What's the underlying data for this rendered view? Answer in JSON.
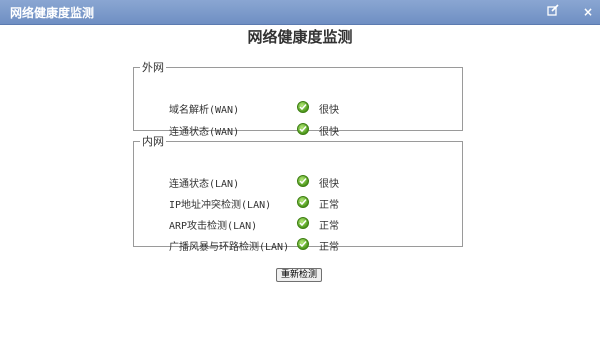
{
  "window": {
    "title": "网络健康度监测",
    "edit_icon": "edit-icon",
    "close_icon": "close-icon"
  },
  "page_title": "网络健康度监测",
  "wan": {
    "legend": "外网",
    "items": [
      {
        "label": "域名解析(WAN)",
        "status": "很快"
      },
      {
        "label": "连通状态(WAN)",
        "status": "很快"
      }
    ]
  },
  "lan": {
    "legend": "内网",
    "items": [
      {
        "label": "连通状态(LAN)",
        "status": "很快"
      },
      {
        "label": "IP地址冲突检测(LAN)",
        "status": "正常"
      },
      {
        "label": "ARP攻击检测(LAN)",
        "status": "正常"
      },
      {
        "label": "广播风暴与环路检测(LAN)",
        "status": "正常"
      }
    ]
  },
  "recheck_button": "重新检测",
  "colors": {
    "titlebar": "#7a98c9",
    "status_ok": "#4e9a1c"
  }
}
